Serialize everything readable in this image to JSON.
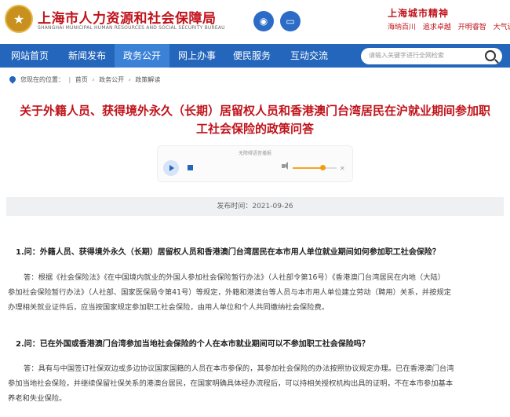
{
  "header": {
    "site_name": "上海市人力资源和社会保障局",
    "site_name_en": "SHANGHAI MUNICIPAL HUMAN RESOURCES AND SOCIAL SECURITY BUREAU",
    "weibo_icon": "weibo-icon",
    "screen_icon": "screen-icon",
    "slogan_title": "上海城市精神",
    "slogan_items": [
      "海纳百川",
      "追求卓越",
      "开明睿智",
      "大气谦和"
    ]
  },
  "nav": {
    "items": [
      "网站首页",
      "新闻发布",
      "政务公开",
      "网上办事",
      "便民服务",
      "互动交流"
    ],
    "active_index": 2,
    "search_placeholder": "请输入关键字进行全网检索"
  },
  "breadcrumb": {
    "prefix": "您现在的位置：",
    "items": [
      "首页",
      "政务公开",
      "政策解读"
    ]
  },
  "article": {
    "title_line1": "关于外籍人员、获得境外永久（长期）居留权人员和香港澳门台湾居民在沪就业期间参加职",
    "title_line2": "工社会保险的政策问答",
    "player_label": "无障碍语音播报",
    "publish_time": "发布时间：2021-09-26",
    "q1": "1.问：外籍人员、获得境外永久（长期）居留权人员和香港澳门台湾居民在本市用人单位就业期间如何参加职工社会保险？",
    "a1_lines": [
      "答：根据《社会保险法》《在中国境内就业的外国人参加社会保险暂行办法》（人社部令第16号）《香港澳门台湾居民在内地（大陆）",
      "参加社会保险暂行办法》（人社部、国家医保局令第41号）等规定，外籍和港澳台等人员与本市用人单位建立劳动（聘用）关系，并按规定",
      "办理相关就业证件后，应当按国家规定参加职工社会保险，由用人单位和个人共同缴纳社会保险费。"
    ],
    "q2": "2.问：已在外国或香港澳门台湾参加当地社会保险的个人在本市就业期间可以不参加职工社会保险吗？",
    "a2_lines": [
      "答：具有与中国签订社保双边或多边协议国家国籍的人员在本市参保的，其参加社会保险的办法按照协议规定办理。已在香港澳门台湾",
      "参加当地社会保险，并继续保留社保关系的港澳台居民，在国家明确具体经办流程后，可以持相关授权机构出具的证明，不在本市参加基本",
      "养老和失业保险。"
    ]
  }
}
